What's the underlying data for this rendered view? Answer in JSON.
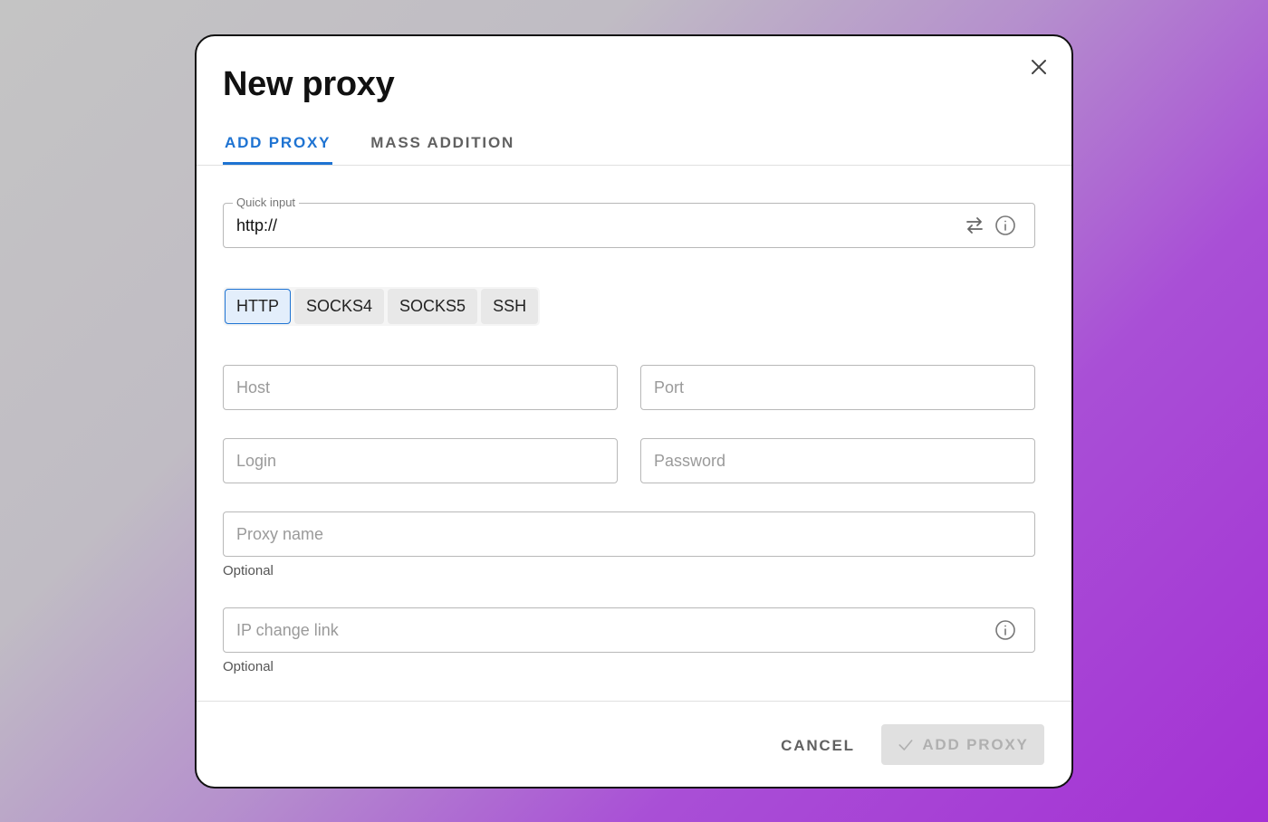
{
  "modal": {
    "title": "New proxy",
    "tabs": [
      {
        "label": "ADD PROXY",
        "active": true
      },
      {
        "label": "MASS ADDITION",
        "active": false
      }
    ],
    "quick_input": {
      "legend": "Quick input",
      "value": "http://"
    },
    "protocols": [
      {
        "label": "HTTP",
        "active": true
      },
      {
        "label": "SOCKS4",
        "active": false
      },
      {
        "label": "SOCKS5",
        "active": false
      },
      {
        "label": "SSH",
        "active": false
      }
    ],
    "fields": {
      "host_placeholder": "Host",
      "port_placeholder": "Port",
      "login_placeholder": "Login",
      "password_placeholder": "Password",
      "proxy_name_placeholder": "Proxy name",
      "proxy_name_helper": "Optional",
      "ip_change_placeholder": "IP change link",
      "ip_change_helper": "Optional"
    },
    "footer": {
      "cancel_label": "CANCEL",
      "add_label": "ADD PROXY"
    }
  },
  "colors": {
    "accent": "#1e73d2",
    "disabled_bg": "#e0e0e0",
    "disabled_text": "#b0b0b0"
  },
  "icons": {
    "close": "close-icon",
    "swap": "swap-arrows-icon",
    "info": "info-icon",
    "check": "check-icon"
  }
}
